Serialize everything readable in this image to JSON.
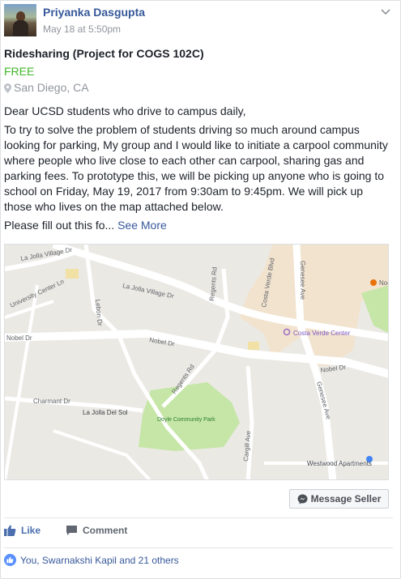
{
  "post": {
    "author": "Priyanka Dasgupta",
    "timestamp": "May 18 at 5:50pm",
    "title": "Ridesharing (Project for COGS 102C)",
    "price": "FREE",
    "location": "San Diego, CA",
    "greeting": "Dear UCSD students who drive to campus daily,",
    "paragraph": "To try to solve the problem of students driving so much around campus looking for parking, My group and I would like to initiate a carpool community where people who live close to each other can carpool, sharing gas and parking fees. To prototype this, we will be picking up anyone who is going to school on Friday, May 19, 2017 from 9:30am to 9:45pm. We will pick up those who lives on the map attached below.",
    "truncated": "Please fill out this fo...",
    "see_more": "See More"
  },
  "map": {
    "labels": {
      "la_jolla_village_dr_top": "La Jolla Village Dr",
      "university_center_ln": "University Center Ln",
      "lebon_dr": "Lebon Dr",
      "la_jolla_village_dr": "La Jolla Village Dr",
      "regents_rd_top": "Regents Rd",
      "costa_verde_blvd": "Costa Verde Blvd",
      "genesee_ave_top": "Genesee Ave",
      "noc": "Noc",
      "nobel_dr_left": "Nobel Dr",
      "nobel_dr_mid": "Nobel Dr",
      "nobel_dr_right": "Nobel Dr",
      "costa_verde_center": "Costa Verde Center",
      "regents_rd": "Regents Rd",
      "genesee_ave": "Genesee Ave",
      "charmant_dr": "Charmant Dr",
      "la_jolla_del_sol": "La Jolla Del Sol",
      "doyle_park": "Doyle Community Park",
      "cargill_ave": "Cargill Ave",
      "westwood_apartments": "Westwood Apartments"
    },
    "colors": {
      "land": "#ebe9e4",
      "road": "#ffffff",
      "park": "#c5e6a6",
      "commercial": "#f2e3cf",
      "pin": "#4285f4"
    }
  },
  "actions": {
    "message_seller": "Message Seller",
    "like": "Like",
    "comment": "Comment"
  },
  "reactions": {
    "text": "You, Swarnakshi Kapil and 21 others"
  },
  "colors": {
    "link": "#365899",
    "price": "#42b72a",
    "meta": "#90949c"
  }
}
